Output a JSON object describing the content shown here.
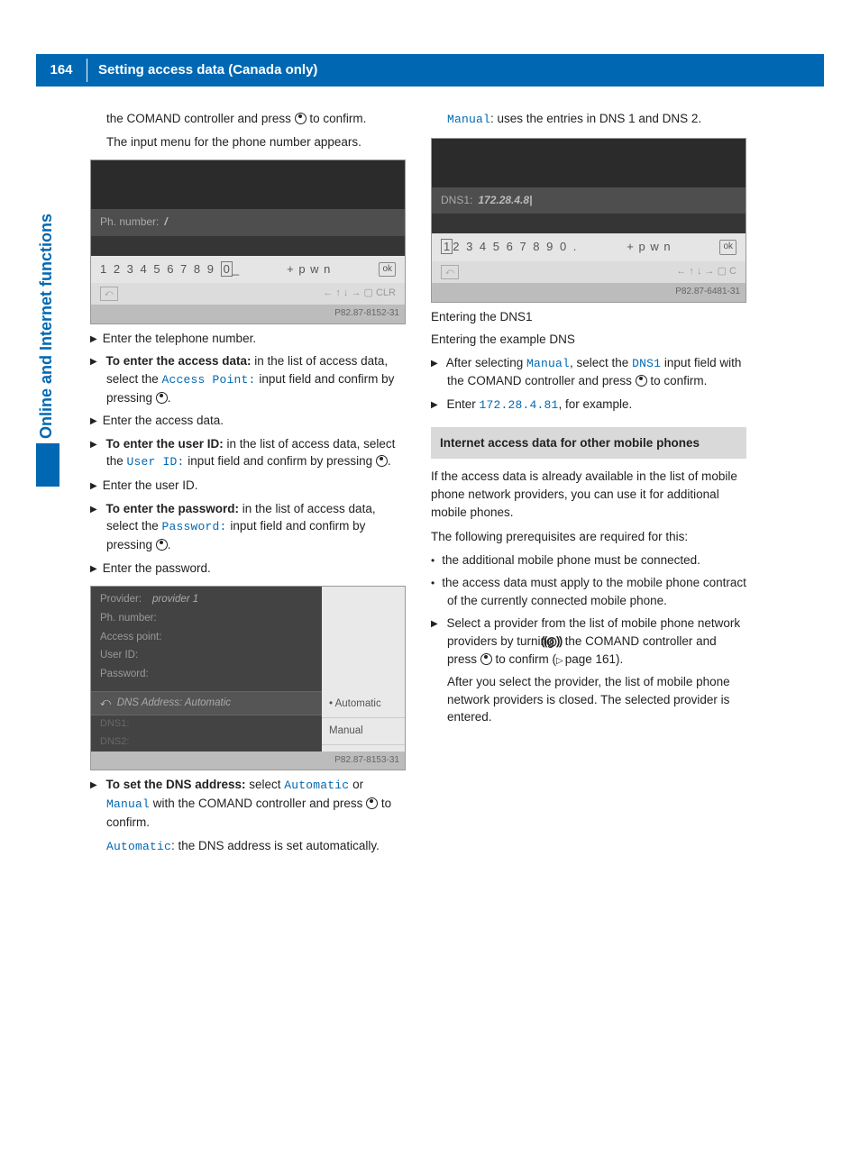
{
  "page_number": "164",
  "header_title": "Setting access data (Canada only)",
  "side_label": "Online and Internet functions",
  "col1": {
    "intro1": "the COMAND controller and press ",
    "intro1b": " to confirm.",
    "intro2": "The input menu for the phone number appears.",
    "ss1": {
      "label": "Ph. number:",
      "val": "/",
      "keypad_digits": "1 2 3 4 5 6 7 8 9",
      "zero": "0",
      "underscore": "_",
      "extra": "+ p w n",
      "ok": "ok",
      "nav_left_box": "⤺",
      "nav_right": "← ↑ ↓ → ▢ CLR",
      "footer": "P82.87-8152-31"
    },
    "s1": "Enter the telephone number.",
    "s2_bold": "To enter the access data:",
    "s2_text": " in the list of access data, select the ",
    "s2_tech": "Access Point:",
    "s2_end": " input field and confirm by pressing ",
    "s3": "Enter the access data.",
    "s4_bold": "To enter the user ID:",
    "s4_text": " in the list of access data, select the ",
    "s4_tech": "User ID:",
    "s4_end": " input field and confirm by pressing ",
    "s5": "Enter the user ID.",
    "s6_bold": "To enter the password:",
    "s6_text": " in the list of access data, select the ",
    "s6_tech": "Password:",
    "s6_end": " input field and confirm by pressing ",
    "s7": "Enter the password.",
    "ss2": {
      "provider_lbl": "Provider:",
      "provider_val": "provider 1",
      "ph_lbl": "Ph. number:",
      "ap_lbl": "Access point:",
      "uid_lbl": "User ID:",
      "pwd_lbl": "Password:",
      "dns_row": "DNS Address: Automatic",
      "dns1": "DNS1:",
      "dns2": "DNS2:",
      "opt_auto": "Automatic",
      "opt_manual": "Manual",
      "footer": "P82.87-8153-31"
    },
    "s8_bold": "To set the DNS address:",
    "s8_text": " select ",
    "s8_tech1": "Automatic",
    "s8_or": " or ",
    "s8_tech2": "Manual",
    "s8_end": " with the COMAND controller and press ",
    "s8_end2": " to confirm.",
    "s8_auto": ": the DNS address is set automatically."
  },
  "col2": {
    "manual_tech": "Manual",
    "manual_text": ": uses the entries in DNS 1 and DNS 2.",
    "ss3": {
      "label": "DNS1:",
      "val": "172.28.4.8|",
      "keypad_digits": "2 3 4 5 6 7 8 9 0 .",
      "one": "1",
      "extra": "+ p w n",
      "ok": "ok",
      "nav_right": "← ↑ ↓ → ▢   C  ",
      "footer": "P82.87-6481-31"
    },
    "caption1": "Entering the DNS1",
    "caption2": "Entering the example DNS",
    "s1a": "After selecting ",
    "s1_tech1": "Manual",
    "s1b": ", select the ",
    "s1_tech2": "DNS1",
    "s1c": " input field with the COMAND controller and press ",
    "s1d": " to confirm.",
    "s2a": "Enter ",
    "s2_tech": "172.28.4.81",
    "s2b": ", for example.",
    "section_title": "Internet access data for other mobile phones",
    "p1": "If the access data is already available in the list of mobile phone network providers, you can use it for additional mobile phones.",
    "p2": "The following prerequisites are required for this:",
    "b1": "the additional mobile phone must be connected.",
    "b2": "the access data must apply to the mobile phone contract of the currently connected mobile phone.",
    "s3a": "Select a provider from the list of mobile phone network providers by turning ",
    "rotary": "⸨◎⸩",
    "s3b": " the COMAND controller and press ",
    "s3c": " to confirm (",
    "page_ref": "page 161",
    "s3d": ").",
    "s3e": "After you select the provider, the list of mobile phone network providers is closed. The selected provider is entered."
  }
}
